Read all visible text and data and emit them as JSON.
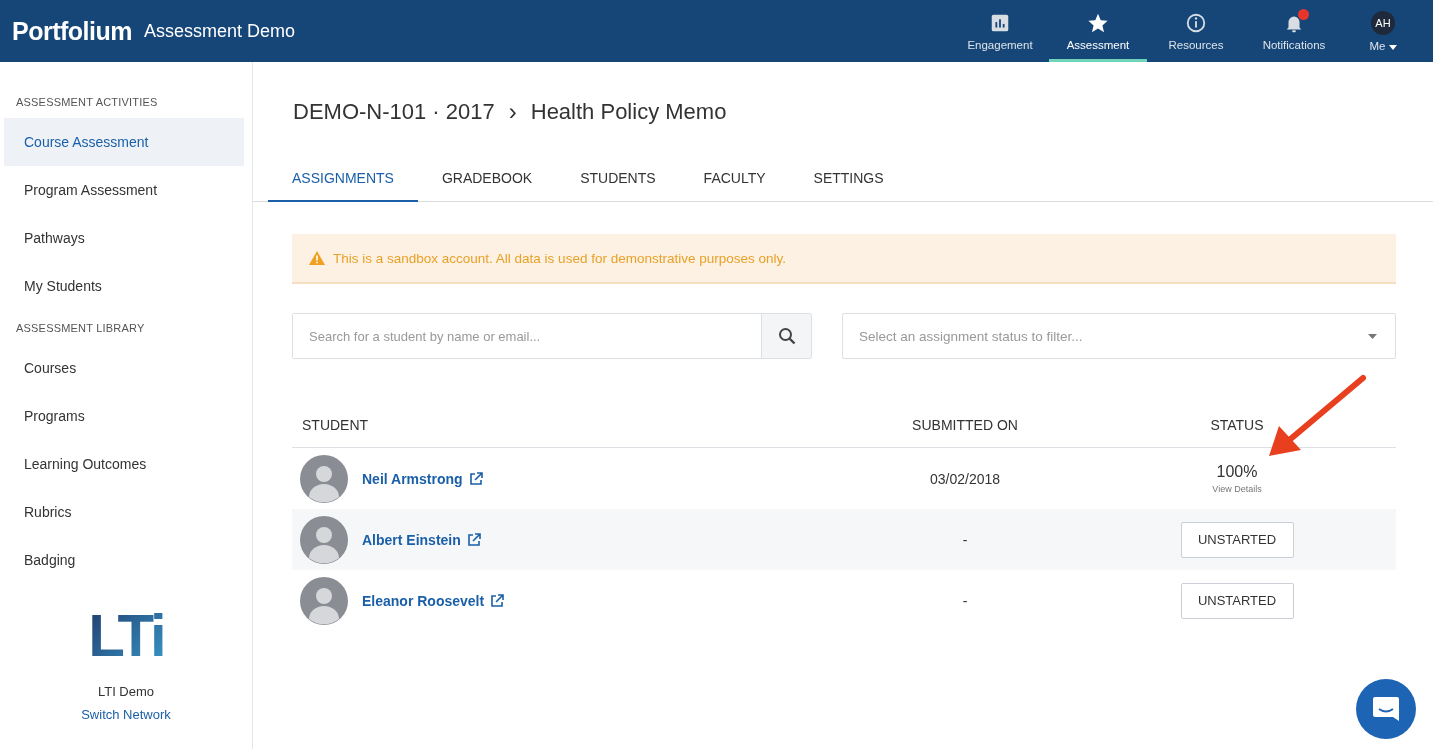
{
  "header": {
    "brand": "Portfolium",
    "title": "Assessment Demo",
    "nav": [
      {
        "label": "Engagement",
        "selected": false,
        "badge": false
      },
      {
        "label": "Assessment",
        "selected": true,
        "badge": false
      },
      {
        "label": "Resources",
        "selected": false,
        "badge": false
      },
      {
        "label": "Notifications",
        "selected": false,
        "badge": true
      }
    ],
    "user": {
      "initials": "AH",
      "label": "Me"
    }
  },
  "sidebar": {
    "sections": [
      {
        "heading": "ASSESSMENT ACTIVITIES",
        "items": [
          {
            "label": "Course Assessment",
            "selected": true
          },
          {
            "label": "Program Assessment",
            "selected": false
          },
          {
            "label": "Pathways",
            "selected": false
          },
          {
            "label": "My Students",
            "selected": false
          }
        ]
      },
      {
        "heading": "ASSESSMENT LIBRARY",
        "items": [
          {
            "label": "Courses",
            "selected": false
          },
          {
            "label": "Programs",
            "selected": false
          },
          {
            "label": "Learning Outcomes",
            "selected": false
          },
          {
            "label": "Rubrics",
            "selected": false
          },
          {
            "label": "Badging",
            "selected": false
          }
        ]
      }
    ],
    "network": {
      "logo": "LTi",
      "name": "LTI Demo",
      "link": "Switch Network"
    }
  },
  "breadcrumb": {
    "parent": "DEMO-N-101 · 2017",
    "separator": "›",
    "current": "Health Policy Memo"
  },
  "tabs": [
    {
      "label": "ASSIGNMENTS",
      "selected": true
    },
    {
      "label": "GRADEBOOK",
      "selected": false
    },
    {
      "label": "STUDENTS",
      "selected": false
    },
    {
      "label": "FACULTY",
      "selected": false
    },
    {
      "label": "SETTINGS",
      "selected": false
    }
  ],
  "alert": "This is a sandbox account. All data is used for demonstrative purposes only.",
  "search": {
    "placeholder": "Search for a student by name or email..."
  },
  "filter": {
    "placeholder": "Select an assignment status to filter..."
  },
  "table": {
    "columns": [
      "STUDENT",
      "SUBMITTED ON",
      "STATUS"
    ],
    "rows": [
      {
        "student": "Neil Armstrong",
        "submitted": "03/02/2018",
        "status": {
          "kind": "percent",
          "value": "100%",
          "link": "View Details"
        }
      },
      {
        "student": "Albert Einstein",
        "submitted": "-",
        "status": {
          "kind": "button",
          "value": "UNSTARTED"
        }
      },
      {
        "student": "Eleanor Roosevelt",
        "submitted": "-",
        "status": {
          "kind": "button",
          "value": "UNSTARTED"
        }
      }
    ]
  }
}
